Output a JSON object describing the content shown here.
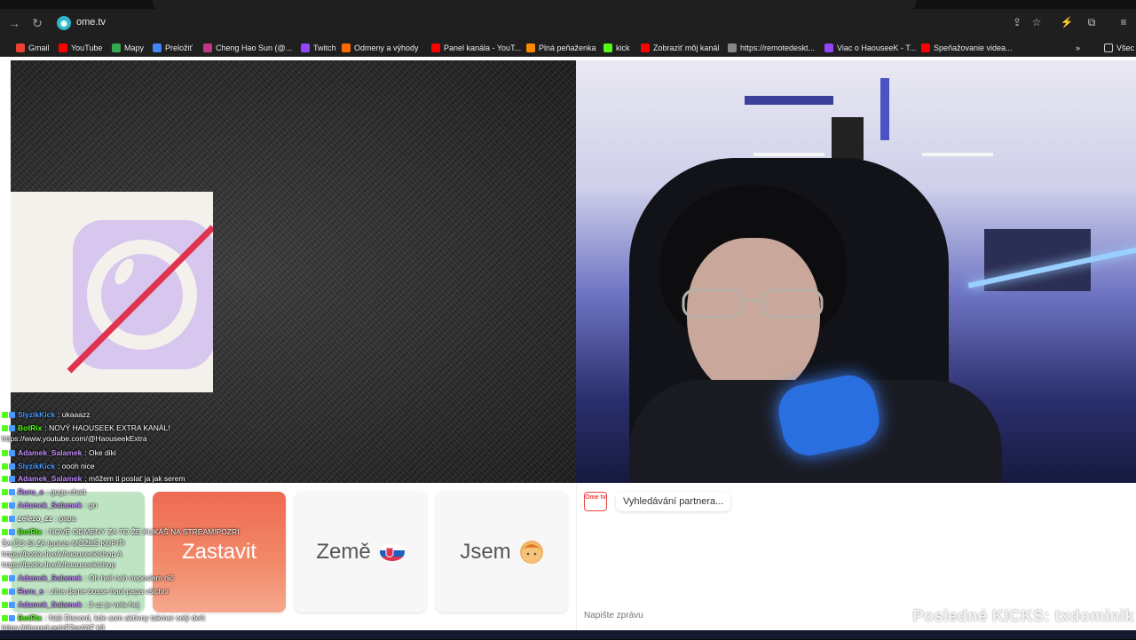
{
  "browser": {
    "url": "ome.tv",
    "bookmarks": [
      {
        "label": "Gmail",
        "color": "#ea4335"
      },
      {
        "label": "YouTube",
        "color": "#ff0000"
      },
      {
        "label": "Mapy",
        "color": "#34a853"
      },
      {
        "label": "Preložiť",
        "color": "#4285f4"
      },
      {
        "label": "Cheng Hao Sun (@...",
        "color": "#c13584"
      },
      {
        "label": "Twitch",
        "color": "#9146ff"
      },
      {
        "label": "Odmeny a výhody",
        "color": "#ff6a00"
      },
      {
        "label": "Panel kanála - YouT...",
        "color": "#ff0000"
      },
      {
        "label": "Plná peňaženka",
        "color": "#ff8a00"
      },
      {
        "label": "kick",
        "color": "#53fc18"
      },
      {
        "label": "Zobraziť môj kanál",
        "color": "#ff0000"
      },
      {
        "label": "https://remotedeskt...",
        "color": "#888888"
      },
      {
        "label": "Viac o HaouseeK - T...",
        "color": "#9146ff"
      },
      {
        "label": "Speňažovanie videa...",
        "color": "#ff0000"
      }
    ],
    "other_bookmarks": "Všec"
  },
  "chat_overlay": [
    {
      "user": "SlyzikKick",
      "text": ": ukaaazz",
      "color": "#4a9bff"
    },
    {
      "user": "BotRix",
      "text": ": NOVÝ HAOUSEEK EXTRA KANÁL!",
      "color": "#53fc18"
    },
    {
      "user": "",
      "text": "https://www.youtube.com/@HaouseekExtra",
      "color": "#ffffff"
    },
    {
      "user": "Adamek_Salamek",
      "text": ": Oke diki",
      "color": "#c28cff"
    },
    {
      "user": "SlyzikKick",
      "text": ": oooh nice",
      "color": "#4a9bff"
    },
    {
      "user": "Adamek_Salamek",
      "text": ": môžem ti poslať ja jak serem",
      "color": "#c28cff"
    },
    {
      "user": "Ruru_s",
      "text": ": gugu chatt",
      "color": "#c28cff"
    },
    {
      "user": "Adamek_Salamek",
      "text": ": gn",
      "color": "#c28cff"
    },
    {
      "user": "zelezo_zz",
      "text": ": papa",
      "color": "#ffffff"
    },
    {
      "user": "BotRix",
      "text": ": NOVÉ ODMENY ZA TO ŽE KUKÁŠ NA STREAM!POZRI",
      "color": "#53fc18"
    },
    {
      "user": "",
      "text": "ŠA ČO SI ZA !points MÔŽEŠ KÚPIŤ!",
      "color": "#ffffff"
    },
    {
      "user": "",
      "text": "https://botrix.live/k/haouseek/shop A",
      "color": "#ffffff"
    },
    {
      "user": "",
      "text": "https://botrix.live/k/haouseek/shop",
      "color": "#ffffff"
    },
    {
      "user": "Adamek_Salamek",
      "text": ": Oh hell nah neposlem nič",
      "color": "#c28cff"
    },
    {
      "user": "Ruru_s",
      "text": ": zitra dame bosse haoi papa všichni",
      "color": "#c28cff"
    },
    {
      "user": "Adamek_Salamek",
      "text": ": 3 uz je vela hej",
      "color": "#c28cff"
    },
    {
      "user": "BotRix",
      "text": ": Náš Discord, kde som aktívny takmer celý deň:",
      "color": "#53fc18"
    },
    {
      "user": "",
      "text": "https://discord.gg/zF2qr4AF k9",
      "color": "#ffffff"
    }
  ],
  "controls": {
    "stop_label": "Zastavit",
    "country_label": "Země",
    "gender_label": "Jsem"
  },
  "chat_panel": {
    "logo_text": "Ome tv",
    "status_message": "Vyhledávání partnera...",
    "input_placeholder": "Napište zprávu"
  },
  "stream_overlay": {
    "kicks_text": "Posledné KICKS: txdominik"
  },
  "colors": {
    "stop_button": "#ee6a52",
    "start_button": "#bfe4c4",
    "no_camera_icon": "#d7c6ee",
    "no_camera_slash": "#e0334f"
  }
}
